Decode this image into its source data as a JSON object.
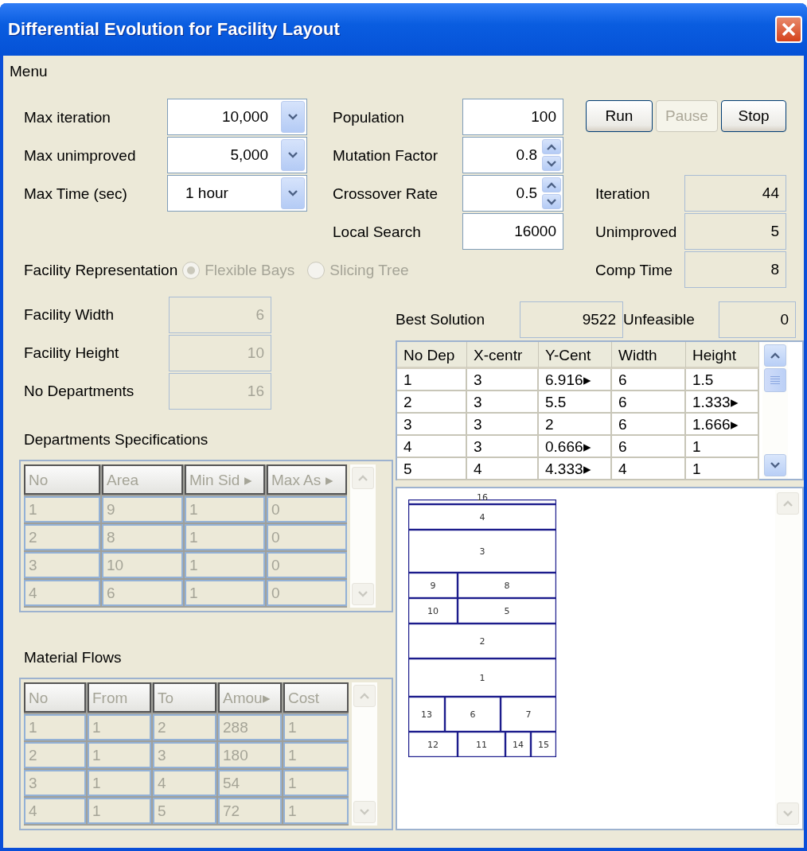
{
  "window": {
    "title": "Differential Evolution for Facility Layout"
  },
  "menu_bar": [
    "Menu"
  ],
  "parameters": [
    {
      "label": "Max iteration",
      "kind": "dropdown",
      "value": "10,000"
    },
    {
      "label": "Max unimproved",
      "kind": "dropdown",
      "value": "5,000"
    },
    {
      "label": "Max Time (sec)",
      "kind": "dropdown",
      "value": "1 hour"
    }
  ],
  "settings": [
    {
      "label": "Population",
      "kind": "text",
      "value": "100"
    },
    {
      "label": "Mutation Factor",
      "kind": "spinner",
      "value": "0.8"
    },
    {
      "label": "Crossover Rate",
      "kind": "spinner",
      "value": "0.5"
    },
    {
      "label": "Local Search",
      "kind": "text",
      "value": "16000"
    }
  ],
  "buttons": [
    {
      "label": "Run",
      "disabled": false
    },
    {
      "label": "Pause",
      "disabled": true
    },
    {
      "label": "Stop",
      "disabled": false
    }
  ],
  "progress": [
    {
      "label": "Iteration",
      "value": "44"
    },
    {
      "label": "Unimproved",
      "value": "5"
    },
    {
      "label": "Comp Time",
      "value": "8"
    }
  ],
  "representation": {
    "label": "Facility Representation",
    "options": [
      {
        "label": "Flexible Bays",
        "selected": true,
        "disabled": true
      },
      {
        "label": "Slicing Tree",
        "selected": false,
        "disabled": true
      }
    ]
  },
  "facility": [
    {
      "label": "Facility Width",
      "value": "6",
      "disabled": true
    },
    {
      "label": "Facility Height",
      "value": "10",
      "disabled": true
    },
    {
      "label": "No Departments",
      "value": "16",
      "disabled": true
    }
  ],
  "departments": {
    "title": "Departments Specifications",
    "disabled": true,
    "columns": [
      "No",
      "Area",
      "Min Sid ▸",
      "Max As ▸"
    ],
    "rows": [
      [
        "1",
        "9",
        "1",
        "0"
      ],
      [
        "2",
        "8",
        "1",
        "0"
      ],
      [
        "3",
        "10",
        "1",
        "0"
      ],
      [
        "4",
        "6",
        "1",
        "0"
      ]
    ]
  },
  "material_flows": {
    "title": "Material Flows",
    "disabled": true,
    "columns": [
      "No",
      "From",
      "To",
      "Amou▸",
      "Cost"
    ],
    "rows": [
      [
        "1",
        "1",
        "2",
        "288",
        "1"
      ],
      [
        "2",
        "1",
        "3",
        "180",
        "1"
      ],
      [
        "3",
        "1",
        "4",
        "54",
        "1"
      ],
      [
        "4",
        "1",
        "5",
        "72",
        "1"
      ]
    ]
  },
  "results": [
    {
      "label": "Best Solution",
      "value": "9522"
    },
    {
      "label": "Unfeasible",
      "value": "0"
    }
  ],
  "solution_table": {
    "disabled": false,
    "columns": [
      "No Dep",
      "X-centr",
      "Y-Cent",
      "Width",
      "Height"
    ],
    "rows": [
      [
        "1",
        "3",
        "6.916▸",
        "6",
        "1.5"
      ],
      [
        "2",
        "3",
        "5.5",
        "6",
        "1.333▸"
      ],
      [
        "3",
        "3",
        "2",
        "6",
        "1.666▸"
      ],
      [
        "4",
        "3",
        "0.666▸",
        "6",
        "1"
      ],
      [
        "5",
        "4",
        "4.333▸",
        "4",
        "1"
      ]
    ]
  },
  "layout_diagram": {
    "departments": [
      "16",
      "4",
      "3",
      "9",
      "8",
      "10",
      "5",
      "2",
      "1",
      "13",
      "6",
      "7",
      "12",
      "11",
      "14",
      "15"
    ]
  }
}
